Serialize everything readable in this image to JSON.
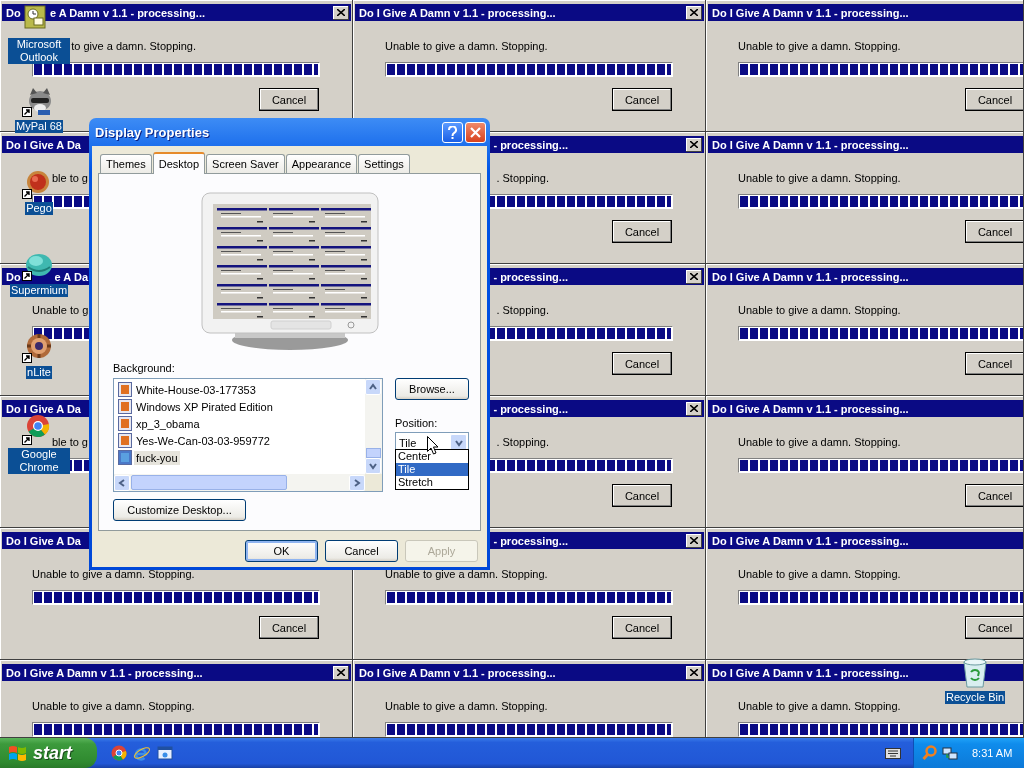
{
  "wallpaper_tiles": [
    {
      "kind": "whole",
      "title": "Do",
      "title_end": "e A Damn v 1.1 - processing...",
      "close": true,
      "message_end": "to give a damn. Stopping.",
      "level": 1,
      "button": "Cancel"
    },
    {
      "kind": "whole",
      "title": "Do I Give A Damn v 1.1 - processing...",
      "close": true,
      "message": "Unable to give a damn. Stopping.",
      "level": 1,
      "button": "Cancel"
    },
    {
      "kind": "whole",
      "title": "Do I Give A Damn v 1.1 - processing...",
      "message": "Unable to give a damn. Stopping.",
      "level": 1,
      "button": "Cancel"
    },
    {
      "kind": "left-of-dialog",
      "title": "Do I Give A Da",
      "message_end": "ble to g",
      "level": 1
    },
    {
      "kind": "right-of-dialog",
      "title_end": "- processing...",
      "close": true,
      "message_end": ". Stopping.",
      "level": 1,
      "button": "Cancel"
    },
    {
      "kind": "whole",
      "title": "Do I Give A Damn v 1.1 - processing...",
      "message": "Unable to give a damn. Stopping.",
      "level": 1,
      "button": "Cancel"
    },
    {
      "kind": "left-of-dialog",
      "title": "Do",
      "title_end": "e A Da",
      "message": "Unable to g",
      "level": 1
    },
    {
      "kind": "right-of-dialog",
      "title_end": "- processing...",
      "close": true,
      "message_end": ". Stopping.",
      "level": 1,
      "button": "Cancel"
    },
    {
      "kind": "whole",
      "title": "Do I Give A Damn v 1.1 - processing...",
      "message": "Unable to give a damn. Stopping.",
      "level": 1,
      "button": "Cancel"
    },
    {
      "kind": "left-of-dialog",
      "title": "Do I Give A Da",
      "message_end": "ble to g",
      "level": 1
    },
    {
      "kind": "right-of-dialog",
      "title_end": "- processing...",
      "close": true,
      "message_end": ". Stopping.",
      "level": 1,
      "button": "Cancel"
    },
    {
      "kind": "whole",
      "title": "Do I Give A Damn v 1.1 - processing...",
      "message": "Unable to give a damn. Stopping.",
      "level": 1,
      "button": "Cancel"
    },
    {
      "kind": "left-of-dialog",
      "title": "Do I Give A Da",
      "message": "Unable to give a damn. Stopping.",
      "level": 1,
      "button": "Cancel"
    },
    {
      "kind": "right-of-dialog",
      "title_end": "- processing...",
      "close": true,
      "message": "Unable to give a damn. Stopping.",
      "level": 1,
      "button": "Cancel"
    },
    {
      "kind": "whole",
      "title": "Do I Give A Damn v 1.1 - processing...",
      "message": "Unable to give a damn. Stopping.",
      "level": 1,
      "button": "Cancel"
    },
    {
      "kind": "whole",
      "title": "Do I Give A Damn v 1.1 - processing...",
      "close": true,
      "message": "Unable to give a damn. Stopping.",
      "level": 1
    },
    {
      "kind": "whole",
      "title": "Do I Give A Damn v 1.1 - processing...",
      "close": true,
      "message": "Unable to give a damn. Stopping.",
      "level": 1
    },
    {
      "kind": "whole",
      "title": "Do I Give A Damn v 1.1 - processing...",
      "message": "Unable to give a damn. Stopping.",
      "level": 1
    }
  ],
  "desktop_icons": [
    {
      "label": "Microsoft Outlook",
      "shortcut": false
    },
    {
      "label": "MyPal 68",
      "shortcut": true
    },
    {
      "label": "Pego",
      "shortcut": true
    },
    {
      "label": "Supermium",
      "shortcut": true
    },
    {
      "label": "nLite",
      "shortcut": true
    },
    {
      "label": "Google Chrome",
      "shortcut": true
    }
  ],
  "recycle_bin": {
    "label": "Recycle Bin"
  },
  "dialog": {
    "title": "Display Properties",
    "tabs": [
      {
        "label": "Themes",
        "selected": false
      },
      {
        "label": "Desktop",
        "selected": true
      },
      {
        "label": "Screen Saver",
        "selected": false
      },
      {
        "label": "Appearance",
        "selected": false
      },
      {
        "label": "Settings",
        "selected": false
      }
    ],
    "background_label": "Background:",
    "backgrounds": [
      {
        "name": "White-House-03-177353",
        "selected": false
      },
      {
        "name": "Windows XP Pirated Edition",
        "selected": false
      },
      {
        "name": "xp_3_obama",
        "selected": false
      },
      {
        "name": "Yes-We-Can-03-03-959772",
        "selected": false
      },
      {
        "name": "fuck-you",
        "selected": true
      }
    ],
    "browse_button": "Browse...",
    "position_label": "Position:",
    "position": {
      "value": "Tile",
      "expanded": true,
      "options": [
        {
          "label": "Center",
          "selected": false
        },
        {
          "label": "Tile",
          "selected": true
        },
        {
          "label": "Stretch",
          "selected": false
        }
      ]
    },
    "customize_button": "Customize Desktop...",
    "buttons": [
      {
        "label": "OK",
        "default": true,
        "disabled": false
      },
      {
        "label": "Cancel",
        "default": false,
        "disabled": false
      },
      {
        "label": "Apply",
        "default": false,
        "disabled": true
      }
    ]
  },
  "taskbar": {
    "start": "start",
    "clock": "8:31 AM"
  }
}
